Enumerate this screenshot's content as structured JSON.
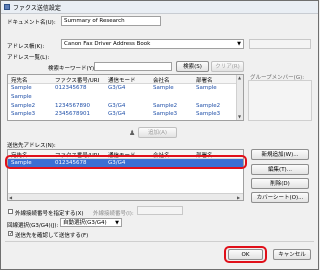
{
  "window": {
    "title": "ファクス送信設定"
  },
  "document_name": {
    "label": "ドキュメント名(U):",
    "value": "Summary of Research"
  },
  "address_book": {
    "label": "アドレス帳(K):",
    "value": "Canon Fax Driver Address Book"
  },
  "address_list": {
    "label": "アドレス一覧(L):",
    "search_label": "検索キーワード(Y):",
    "search_value": "",
    "search_button": "検索(S)",
    "clear_button": "クリア(R)",
    "group_member_label": "グループメンバー(G):",
    "columns": [
      "宛先名",
      "ファクス番号/URI",
      "通信モード",
      "会社名",
      "部署名"
    ],
    "rows": [
      [
        "Sample",
        "012345678",
        "G3/G4",
        "Sample",
        "Sample"
      ],
      [
        "Sample",
        "",
        "",
        "",
        ""
      ],
      [
        "Sample2",
        "1234567890",
        "G3/G4",
        "Sample2",
        "Sample2"
      ],
      [
        "Sample3",
        "2345678901",
        "G3/G4",
        "Sample3",
        "Sample3"
      ]
    ]
  },
  "add_button": "追加(A)",
  "recipients": {
    "label": "送信先アドレス(N):",
    "columns": [
      "宛先名",
      "ファクス番号/URI",
      "通信モード",
      "会社名",
      "部署名"
    ],
    "rows": [
      [
        "Sample",
        "012345678",
        "G3/G4",
        "",
        ""
      ]
    ]
  },
  "side_buttons": {
    "new": "新規追加(W)...",
    "edit": "編集(T)...",
    "delete": "削除(D)",
    "cover": "カバーシート(O)..."
  },
  "outside_line": {
    "label": "外線接続番号を指定する(X)",
    "field_label": "外線接続番号(I):",
    "value": ""
  },
  "line_select": {
    "label": "回線選択(G3/G4)(J):",
    "value": "自動選択(G3/G4)"
  },
  "confirm_check": {
    "label": "送信先を確認して送信する(F)",
    "checked": true
  },
  "footer": {
    "ok": "OK",
    "cancel": "キャンセル"
  }
}
